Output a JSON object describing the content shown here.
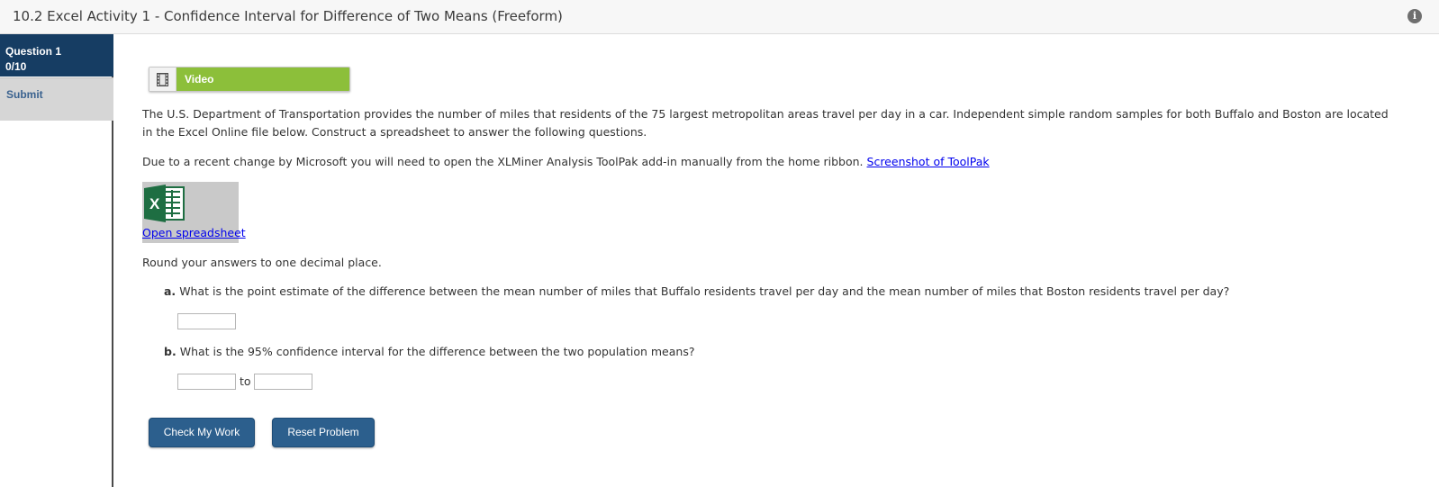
{
  "header": {
    "title": "10.2 Excel Activity 1 - Confidence Interval for Difference of Two Means (Freeform)",
    "info_icon": "info-icon"
  },
  "sidebar": {
    "question_label": "Question 1",
    "question_score": "0/10",
    "submit_label": "Submit"
  },
  "video": {
    "label": "Video",
    "icon": "film-icon"
  },
  "content": {
    "intro": "The U.S. Department of Transportation provides the number of miles that residents of the 75 largest metropolitan areas travel per day in a car. Independent simple random samples for both Buffalo and Boston are located in the Excel Online file below. Construct a spreadsheet to answer the following questions.",
    "notice": "Due to a recent change by Microsoft you will need to open the XLMiner Analysis ToolPak add-in manually from the home ribbon.",
    "notice_link": "Screenshot of ToolPak",
    "spreadsheet_link": "Open spreadsheet",
    "round_instruction": "Round your answers to one decimal place.",
    "question_a_label": "a.",
    "question_a": "What is the point estimate of the difference between the mean number of miles that Buffalo residents travel per day and the mean number of miles that Boston residents travel per day?",
    "answer_a": "",
    "question_b_label": "b.",
    "question_b": "What is the 95% confidence interval for the difference between the two population means?",
    "answer_b_lower": "",
    "answer_b_upper": "",
    "to_label": "to"
  },
  "buttons": {
    "check": "Check My Work",
    "reset": "Reset Problem"
  },
  "colors": {
    "sidebar_active": "#163d63",
    "video_bar": "#8cbf3a",
    "button": "#2c5f8d",
    "excel_green": "#1e6e42"
  }
}
